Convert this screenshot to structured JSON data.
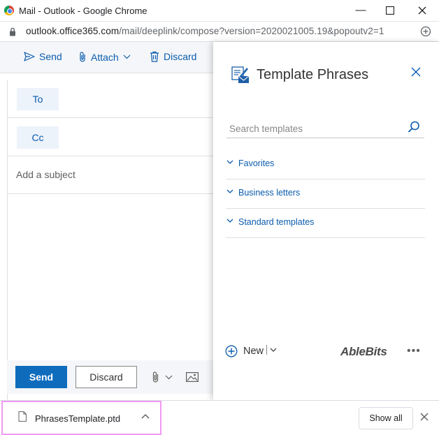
{
  "window": {
    "title": "Mail - Outlook - Google Chrome",
    "minimize_glyph": "—",
    "maximize_glyph": "☐",
    "close_glyph": "✕"
  },
  "address_bar": {
    "host": "outlook.office365.com",
    "path": "/mail/deeplink/compose?version=2020021005.19&popoutv2=1"
  },
  "toolbar": {
    "send_label": "Send",
    "attach_label": "Attach",
    "discard_label": "Discard"
  },
  "compose": {
    "to_label": "To",
    "cc_label": "Cc",
    "subject_placeholder": "Add a subject",
    "send_button": "Send",
    "discard_button": "Discard"
  },
  "template_pane": {
    "title": "Template Phrases",
    "search_placeholder": "Search templates",
    "categories": [
      {
        "label": "Favorites"
      },
      {
        "label": "Business letters"
      },
      {
        "label": "Standard templates"
      }
    ],
    "new_label": "New",
    "brand": "AbleBits",
    "more_glyph": "•••"
  },
  "downloads": {
    "file_name": "PhrasesTemplate.ptd",
    "show_all_label": "Show all"
  },
  "colors": {
    "accent": "#0f6cbd",
    "link": "#0b5cad",
    "download_highlight": "#f09bf3"
  }
}
